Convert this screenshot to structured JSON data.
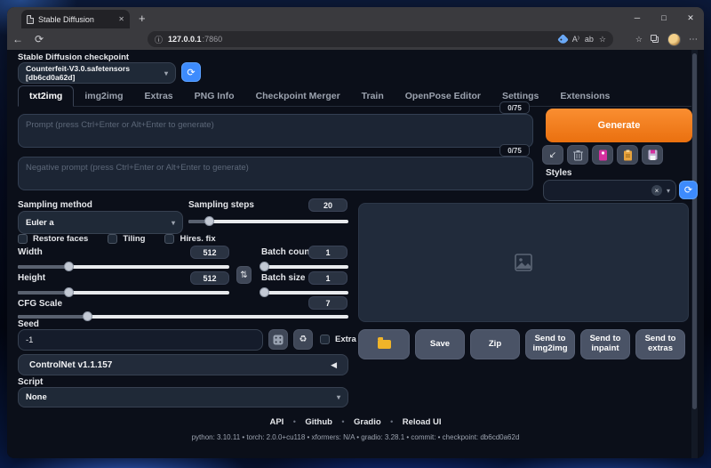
{
  "browser": {
    "tab_title": "Stable Diffusion",
    "close_tab_glyph": "✕",
    "new_tab_glyph": "+",
    "back_glyph": "←",
    "refresh_glyph": "⟳",
    "info_glyph": "ⓘ",
    "url_host": "127.0.0.1",
    "url_port": ":7860",
    "read_aloud_glyph": "A⁾",
    "translate_glyph": "ab",
    "favorites_glyph": "☆",
    "sparkle_star_glyph": "☆",
    "menu_glyph": "⋯",
    "minimize_glyph": "─",
    "maximize_glyph": "□",
    "close_glyph": "✕"
  },
  "checkpoint": {
    "label": "Stable Diffusion checkpoint",
    "value": "Counterfeit-V3.0.safetensors [db6cd0a62d]",
    "caret": "▾",
    "refresh_glyph": "⟳"
  },
  "tabs": {
    "items": [
      {
        "label": "txt2img"
      },
      {
        "label": "img2img"
      },
      {
        "label": "Extras"
      },
      {
        "label": "PNG Info"
      },
      {
        "label": "Checkpoint Merger"
      },
      {
        "label": "Train"
      },
      {
        "label": "OpenPose Editor"
      },
      {
        "label": "Settings"
      },
      {
        "label": "Extensions"
      }
    ]
  },
  "prompt": {
    "placeholder": "Prompt (press Ctrl+Enter or Alt+Enter to generate)",
    "counter": "0/75"
  },
  "negative_prompt": {
    "placeholder": "Negative prompt (press Ctrl+Enter or Alt+Enter to generate)",
    "counter": "0/75"
  },
  "generate": {
    "label": "Generate"
  },
  "tools": {
    "paste_glyph": "↙",
    "recycle_glyph": "♻"
  },
  "styles": {
    "label": "Styles",
    "clear_glyph": "×",
    "caret": "▾",
    "refresh_glyph": "⟳"
  },
  "sampling": {
    "method_label": "Sampling method",
    "method_value": "Euler a",
    "steps_label": "Sampling steps",
    "steps_value": "20"
  },
  "options": {
    "restore_faces": "Restore faces",
    "tiling": "Tiling",
    "hires_fix": "Hires. fix"
  },
  "size": {
    "width_label": "Width",
    "width_value": "512",
    "height_label": "Height",
    "height_value": "512",
    "swap_glyph": "⇅"
  },
  "batch": {
    "count_label": "Batch count",
    "count_value": "1",
    "size_label": "Batch size",
    "size_value": "1"
  },
  "cfg": {
    "label": "CFG Scale",
    "value": "7"
  },
  "seed": {
    "label": "Seed",
    "value": "-1",
    "extra_label": "Extra"
  },
  "controlnet": {
    "label": "ControlNet v1.1.157",
    "collapse_glyph": "◀"
  },
  "script": {
    "label": "Script",
    "value": "None",
    "caret": "▾"
  },
  "output": {
    "save": "Save",
    "zip": "Zip",
    "send_img2img": "Send to img2img",
    "send_inpaint": "Send to inpaint",
    "send_extras": "Send to extras"
  },
  "footer": {
    "links": [
      {
        "label": "API"
      },
      {
        "label": "Github"
      },
      {
        "label": "Gradio"
      },
      {
        "label": "Reload UI"
      }
    ],
    "sep": "•",
    "versions": "python: 3.10.11  •  torch: 2.0.0+cu118  •  xformers: N/A  •  gradio: 3.28.1  •  commit:  •  checkpoint: db6cd0a62d"
  }
}
